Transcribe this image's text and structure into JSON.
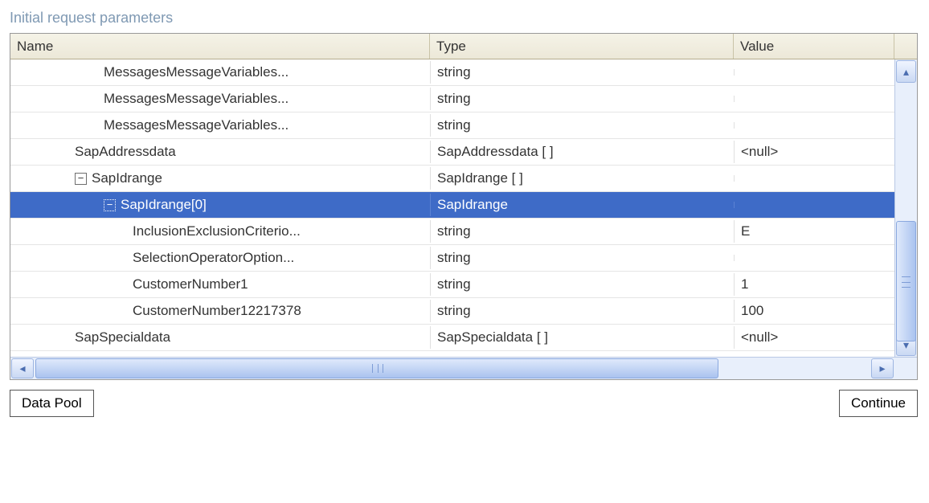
{
  "panel": {
    "title": "Initial request parameters"
  },
  "columns": {
    "name": "Name",
    "type": "Type",
    "value": "Value"
  },
  "rows": [
    {
      "indent": 3,
      "expander": "",
      "name": "MessagesMessageVariables...",
      "type": "string",
      "value": "",
      "selected": false
    },
    {
      "indent": 3,
      "expander": "",
      "name": "MessagesMessageVariables...",
      "type": "string",
      "value": "",
      "selected": false
    },
    {
      "indent": 3,
      "expander": "",
      "name": "MessagesMessageVariables...",
      "type": "string",
      "value": "",
      "selected": false
    },
    {
      "indent": 2,
      "expander": "",
      "name": "SapAddressdata",
      "type": "SapAddressdata [ ]",
      "value": "<null>",
      "selected": false
    },
    {
      "indent": 2,
      "expander": "-",
      "name": "SapIdrange",
      "type": "SapIdrange [ ]",
      "value": "",
      "selected": false
    },
    {
      "indent": 3,
      "expander": "-",
      "name": "SapIdrange[0]",
      "type": "SapIdrange",
      "value": "",
      "selected": true
    },
    {
      "indent": 4,
      "expander": "",
      "name": "InclusionExclusionCriterio...",
      "type": "string",
      "value": "E",
      "selected": false
    },
    {
      "indent": 4,
      "expander": "",
      "name": "SelectionOperatorOption...",
      "type": "string",
      "value": "",
      "selected": false
    },
    {
      "indent": 4,
      "expander": "",
      "name": "CustomerNumber1",
      "type": "string",
      "value": "1",
      "selected": false
    },
    {
      "indent": 4,
      "expander": "",
      "name": "CustomerNumber12217378",
      "type": "string",
      "value": "100",
      "selected": false
    },
    {
      "indent": 2,
      "expander": "",
      "name": "SapSpecialdata",
      "type": "SapSpecialdata [ ]",
      "value": "<null>",
      "selected": false
    }
  ],
  "buttons": {
    "datapool": "Data Pool",
    "continue": "Continue"
  }
}
